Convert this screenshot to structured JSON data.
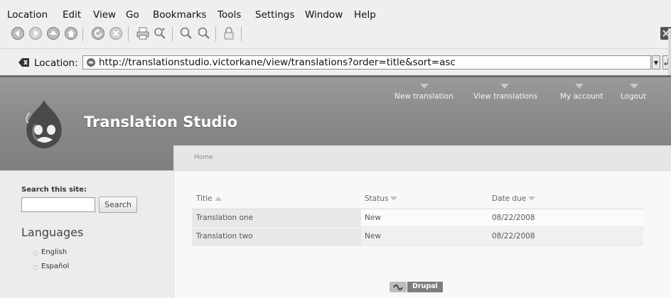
{
  "menubar": {
    "items": [
      {
        "label": "Location"
      },
      {
        "label": "Edit"
      },
      {
        "label": "View"
      },
      {
        "label": "Go"
      },
      {
        "label": "Bookmarks"
      },
      {
        "label": "Tools"
      },
      {
        "label": "Settings"
      },
      {
        "label": "Window"
      },
      {
        "label": "Help"
      }
    ]
  },
  "toolbar": {
    "buttons": [
      "back-icon",
      "forward-icon",
      "up-icon",
      "home-icon",
      "reload-icon",
      "stop-icon",
      "print-icon",
      "find-icon",
      "zoom-in-icon",
      "zoom-out-icon",
      "lock-icon"
    ]
  },
  "location": {
    "label": "Location:",
    "url": "http://translationstudio.victorkane/view/translations?order=title&sort=asc"
  },
  "site": {
    "name": "Translation Studio",
    "nav": [
      {
        "label": "New translation"
      },
      {
        "label": "View translations"
      },
      {
        "label": "My account"
      },
      {
        "label": "Logout"
      }
    ],
    "breadcrumb": "Home"
  },
  "sidebar": {
    "search_title": "Search this site:",
    "search_value": "",
    "search_button": "Search",
    "languages_title": "Languages",
    "languages": [
      {
        "label": "English"
      },
      {
        "label": "Español"
      }
    ]
  },
  "table": {
    "headers": [
      {
        "label": "Title",
        "sort": "asc"
      },
      {
        "label": "Status",
        "sort": "none"
      },
      {
        "label": "Date due",
        "sort": "none"
      }
    ],
    "rows": [
      {
        "title": "Translation one",
        "status": "New",
        "date": "08/22/2008"
      },
      {
        "title": "Translation two",
        "status": "New",
        "date": "08/22/2008"
      }
    ]
  },
  "footer": {
    "badge_text": "Drupal"
  },
  "colors": {
    "header_band": "#8a8a8a",
    "page_background": "#f3f3f3",
    "chrome_background": "#efefef"
  }
}
